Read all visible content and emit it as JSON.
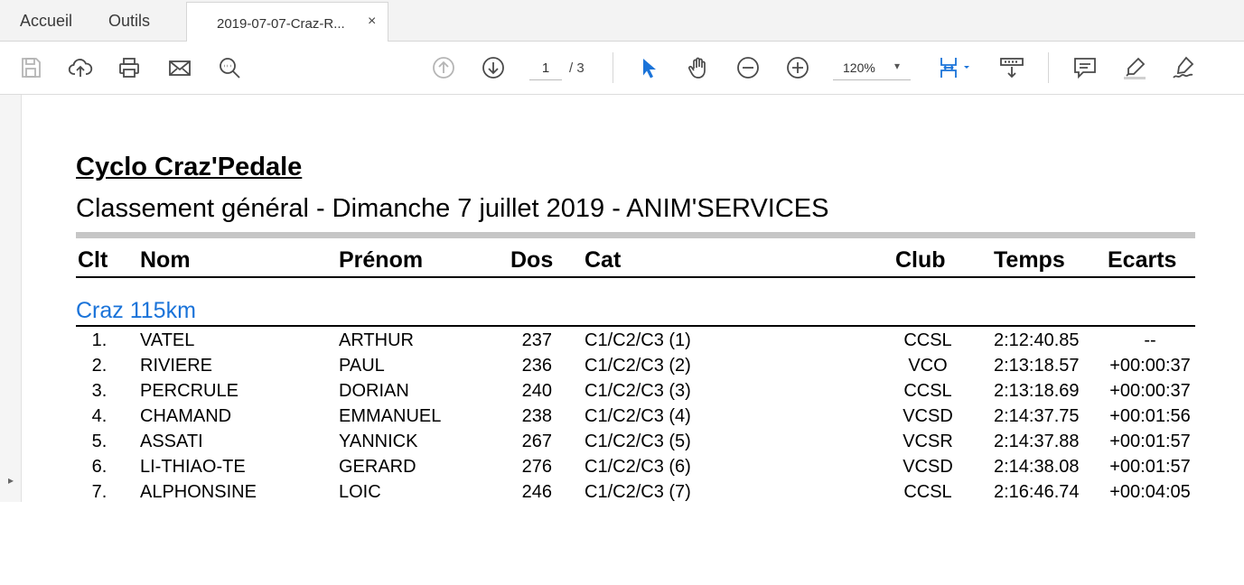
{
  "tabs": {
    "home": "Accueil",
    "tools": "Outils",
    "document": "2019-07-07-Craz-R...",
    "close": "×"
  },
  "toolbar": {
    "current_page": "1",
    "page_total": "/ 3",
    "zoom": "120%",
    "zoom_caret": "▾",
    "accent_color": "#1a73d9",
    "icons": [
      "save-icon",
      "upload-icon",
      "print-icon",
      "email-icon",
      "zoom-search-icon",
      "page-up-icon",
      "page-down-icon",
      "select-cursor-icon",
      "hand-icon",
      "zoom-out-icon",
      "zoom-in-icon",
      "fit-page-icon",
      "scroll-mode-icon",
      "comment-icon",
      "highlight-icon",
      "sign-icon"
    ]
  },
  "sidebar": {
    "toggle": "▸"
  },
  "document": {
    "title": "Cyclo Craz'Pedale",
    "subtitle": "Classement général  - Dimanche 7 juillet 2019 - ANIM'SERVICES",
    "headers": {
      "clt": "Clt",
      "nom": "Nom",
      "prenom": "Prénom",
      "dos": "Dos",
      "cat": "Cat",
      "club": "Club",
      "temps": "Temps",
      "ecarts": "Ecarts"
    },
    "section": "Craz 115km",
    "rows": [
      {
        "clt": "1.",
        "nom": "VATEL",
        "prenom": "ARTHUR",
        "dos": "237",
        "cat": "C1/C2/C3 (1)",
        "club": "CCSL",
        "temps": "2:12:40.85",
        "ecart": "--"
      },
      {
        "clt": "2.",
        "nom": "RIVIERE",
        "prenom": "PAUL",
        "dos": "236",
        "cat": "C1/C2/C3 (2)",
        "club": "VCO",
        "temps": "2:13:18.57",
        "ecart": "+00:00:37"
      },
      {
        "clt": "3.",
        "nom": "PERCRULE",
        "prenom": "DORIAN",
        "dos": "240",
        "cat": "C1/C2/C3 (3)",
        "club": "CCSL",
        "temps": "2:13:18.69",
        "ecart": "+00:00:37"
      },
      {
        "clt": "4.",
        "nom": "CHAMAND",
        "prenom": "EMMANUEL",
        "dos": "238",
        "cat": "C1/C2/C3 (4)",
        "club": "VCSD",
        "temps": "2:14:37.75",
        "ecart": "+00:01:56"
      },
      {
        "clt": "5.",
        "nom": "ASSATI",
        "prenom": "YANNICK",
        "dos": "267",
        "cat": "C1/C2/C3 (5)",
        "club": "VCSR",
        "temps": "2:14:37.88",
        "ecart": "+00:01:57"
      },
      {
        "clt": "6.",
        "nom": "LI-THIAO-TE",
        "prenom": "GERARD",
        "dos": "276",
        "cat": "C1/C2/C3 (6)",
        "club": "VCSD",
        "temps": "2:14:38.08",
        "ecart": "+00:01:57"
      },
      {
        "clt": "7.",
        "nom": "ALPHONSINE",
        "prenom": "LOIC",
        "dos": "246",
        "cat": "C1/C2/C3 (7)",
        "club": "CCSL",
        "temps": "2:16:46.74",
        "ecart": "+00:04:05"
      }
    ]
  }
}
